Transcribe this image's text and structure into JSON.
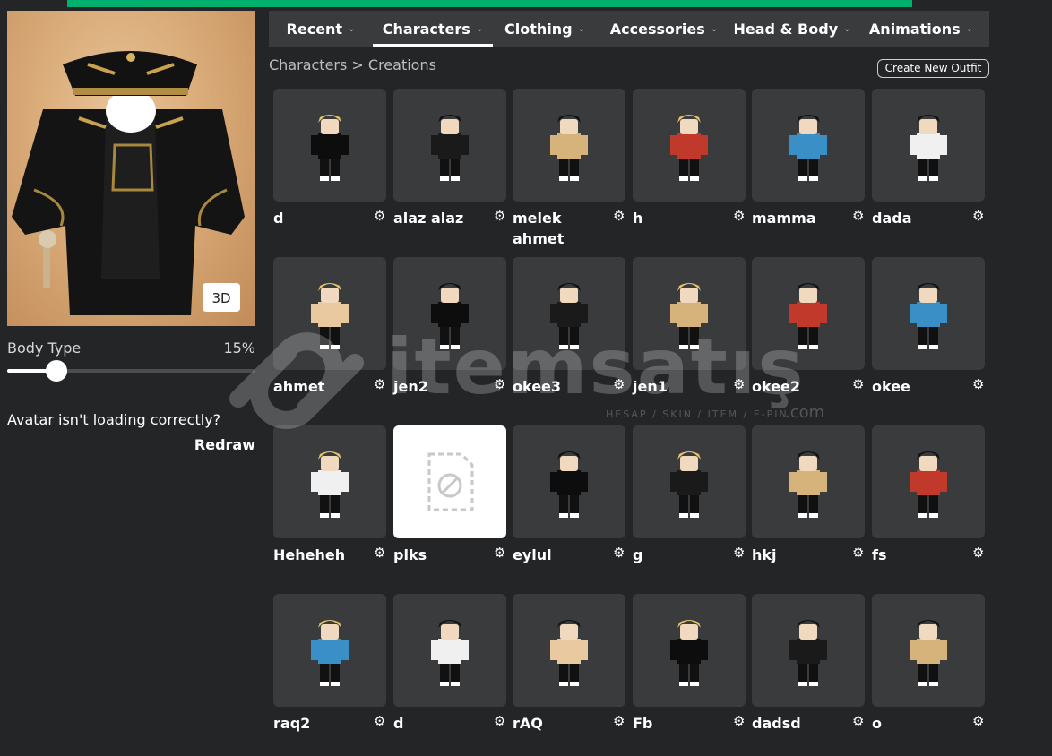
{
  "tabs": [
    {
      "label": "Recent",
      "active": false
    },
    {
      "label": "Characters",
      "active": true
    },
    {
      "label": "Clothing",
      "active": false
    },
    {
      "label": "Accessories",
      "active": false
    },
    {
      "label": "Head & Body",
      "active": false
    },
    {
      "label": "Animations",
      "active": false
    }
  ],
  "breadcrumb": "Characters > Creations",
  "create_outfit_label": "Create New Outfit",
  "avatar": {
    "view_3d_label": "3D",
    "body_type_label": "Body Type",
    "body_type_value": "15%",
    "body_type_fraction": 0.15,
    "help_text": "Avatar isn't loading correctly?",
    "redraw_label": "Redraw"
  },
  "outfits": [
    {
      "name": "d"
    },
    {
      "name": "alaz alaz"
    },
    {
      "name": "melek ahmet"
    },
    {
      "name": "h"
    },
    {
      "name": "mamma"
    },
    {
      "name": "dada"
    },
    {
      "name": "ahmet"
    },
    {
      "name": "jen2"
    },
    {
      "name": "okee3"
    },
    {
      "name": "jen1"
    },
    {
      "name": "okee2"
    },
    {
      "name": "okee"
    },
    {
      "name": "Heheheh"
    },
    {
      "name": "plks",
      "broken": true
    },
    {
      "name": "eylul"
    },
    {
      "name": "g"
    },
    {
      "name": "hkj"
    },
    {
      "name": "fs"
    },
    {
      "name": "raq2"
    },
    {
      "name": "d"
    },
    {
      "name": "rAQ"
    },
    {
      "name": "Fb"
    },
    {
      "name": "dadsd"
    },
    {
      "name": "o"
    }
  ],
  "icons": {
    "gear": "gear-icon",
    "chevron": "chevron-down-icon",
    "broken_image": "broken-image-icon"
  },
  "watermark": {
    "text": "itemsatış",
    "sub": "HESAP / SKIN / ITEM / E-PIN",
    "domain": ".com"
  },
  "colors": {
    "background": "#232527",
    "panel": "#393b3d",
    "accent_top": "#00b06f"
  }
}
